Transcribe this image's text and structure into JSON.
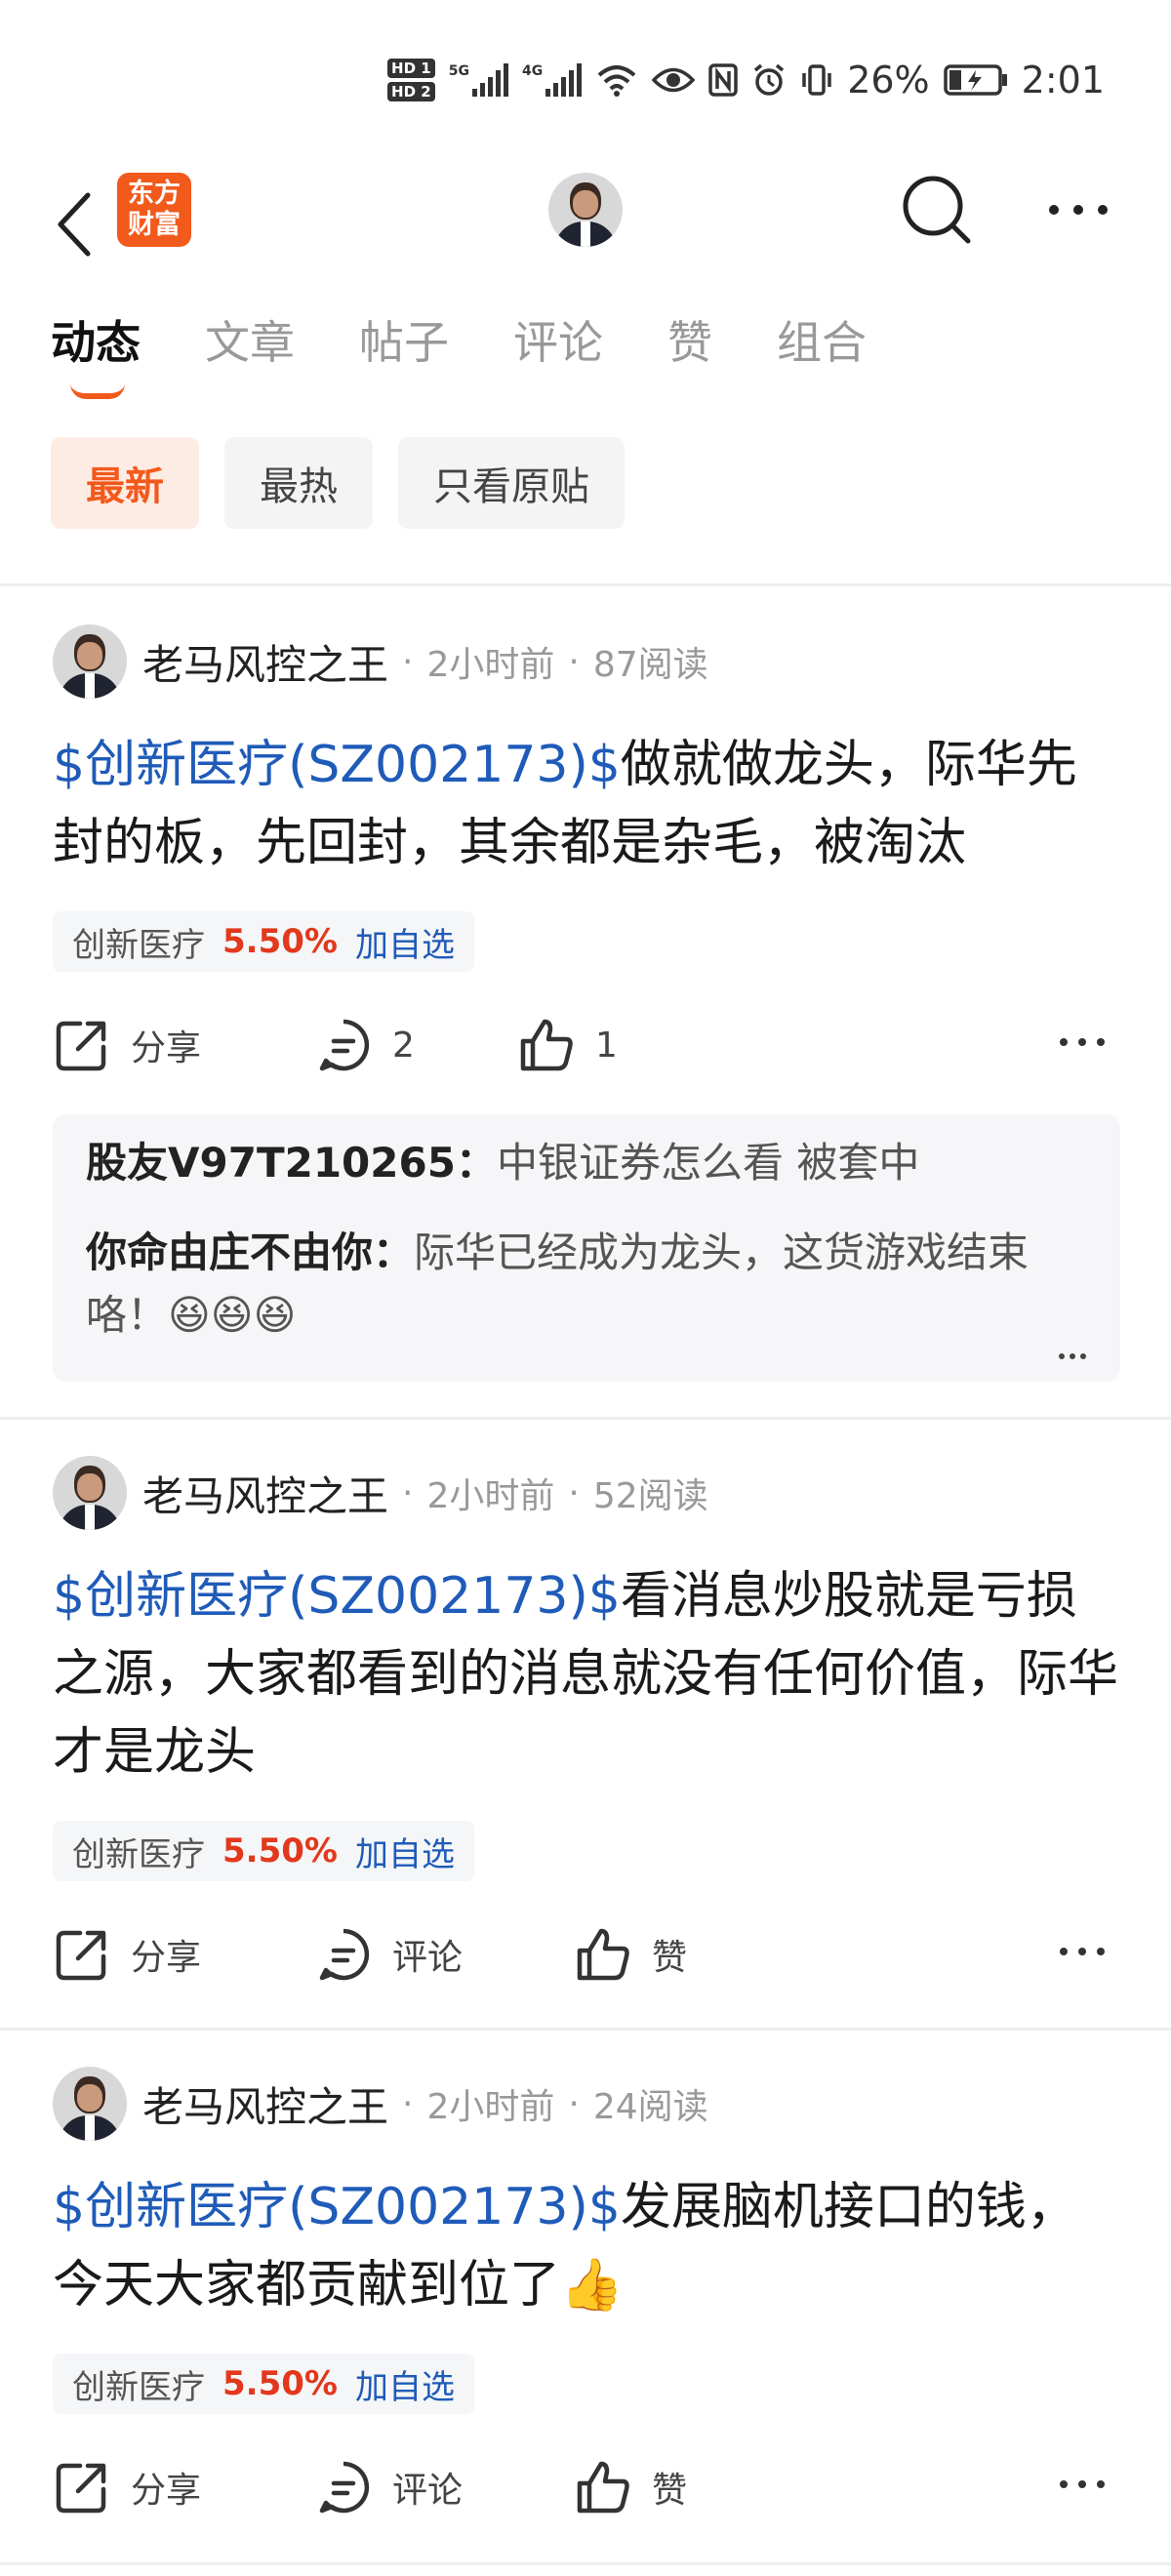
{
  "status_bar": {
    "hd1": "HD 1",
    "hd2": "HD 2",
    "net1": "5G",
    "net2": "4G",
    "battery": "26%",
    "time": "2:01"
  },
  "header": {
    "logo_line1": "东方",
    "logo_line2": "财富"
  },
  "tabs": [
    "动态",
    "文章",
    "帖子",
    "评论",
    "赞",
    "组合"
  ],
  "filters": [
    "最新",
    "最热",
    "只看原贴"
  ],
  "posts": [
    {
      "author": "老马风控之王",
      "time": "2小时前",
      "reads": "87阅读",
      "tag": "$创新医疗(SZ002173)$",
      "text": "做就做龙头，际华先封的板，先回封，其余都是杂毛，被淘汰",
      "stock_name": "创新医疗",
      "stock_change": "5.50%",
      "stock_add": "加自选",
      "share": "分享",
      "comments": "2",
      "likes": "1",
      "replies": [
        {
          "user": "股友V97T210265",
          "text": "中银证券怎么看 被套中"
        },
        {
          "user": "你命由庄不由你",
          "text": "际华已经成为龙头，这货游戏结束咯！",
          "emoji": "😆😆😆"
        }
      ]
    },
    {
      "author": "老马风控之王",
      "time": "2小时前",
      "reads": "52阅读",
      "tag": "$创新医疗(SZ002173)$",
      "text": "看消息炒股就是亏损之源，大家都看到的消息就没有任何价值，际华才是龙头",
      "stock_name": "创新医疗",
      "stock_change": "5.50%",
      "stock_add": "加自选",
      "share": "分享",
      "comments": "评论",
      "likes": "赞"
    },
    {
      "author": "老马风控之王",
      "time": "2小时前",
      "reads": "24阅读",
      "tag": "$创新医疗(SZ002173)$",
      "text": "发展脑机接口的钱，今天大家都贡献到位了👍",
      "stock_name": "创新医疗",
      "stock_change": "5.50%",
      "stock_add": "加自选",
      "share": "分享",
      "comments": "评论",
      "likes": "赞"
    }
  ]
}
